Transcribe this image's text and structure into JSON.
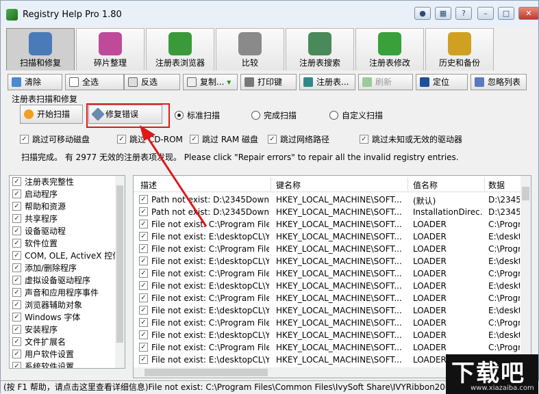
{
  "window": {
    "title": "Registry Help Pro 1.80"
  },
  "tabs": [
    {
      "label": "扫描和修复",
      "icon": "tools-icon",
      "active": true
    },
    {
      "label": "碎片整理",
      "icon": "defrag-icon"
    },
    {
      "label": "注册表浏览器",
      "icon": "cubes-icon"
    },
    {
      "label": "比较",
      "icon": "scale-icon"
    },
    {
      "label": "注册表搜索",
      "icon": "magnifier-icon"
    },
    {
      "label": "注册表修改",
      "icon": "cube-edit-icon"
    },
    {
      "label": "历史和备份",
      "icon": "clock-icon"
    }
  ],
  "toolbar": {
    "clear": "清除",
    "select_all": "全选",
    "invert": "反选",
    "copy": "复制...",
    "print": "打印键",
    "registry": "注册表...",
    "refresh": "刷新",
    "locate": "定位",
    "ignore_list": "忽略列表"
  },
  "scan": {
    "section_title": "注册表扫描和修复",
    "start_label": "开始扫描",
    "repair_label": "修复错误",
    "radio_standard": "标准扫描",
    "radio_full": "完成扫描",
    "radio_custom": "自定义扫描",
    "skip_removable": "跳过可移动磁盘",
    "skip_cdrom": "跳过 CD-ROM",
    "skip_ram": "跳过 RAM 磁盘",
    "skip_network": "跳过网络路径",
    "skip_unknown": "跳过未知或无效的驱动器",
    "status": "扫描完成。 有 2977 无效的注册表项发现。 Please click \"Repair errors\" to repair all the invalid registry entries."
  },
  "categories": [
    "注册表完整性",
    "启动程序",
    "帮助和资源",
    "共享程序",
    "设备驱动程",
    "软件位置",
    "COM, OLE, ActiveX 控件",
    "添加/删除程序",
    "虚拟设备驱动程序",
    "声音和应用程序事件",
    "浏览器辅助对象",
    "Windows 字体",
    "安装程序",
    "文件扩展名",
    "用户软件设置",
    "系统软件设置"
  ],
  "results": {
    "headers": [
      "描述",
      "键名称",
      "值名称",
      "数据"
    ],
    "rows": [
      [
        "Path not exist: D:\\2345Downl...",
        "HKEY_LOCAL_MACHINE\\SOFT...",
        "(默认)",
        "D:\\2345"
      ],
      [
        "Path not exist: D:\\2345Downl...",
        "HKEY_LOCAL_MACHINE\\SOFT...",
        "InstallationDirec...",
        "D:\\2345"
      ],
      [
        "File not exist: C:\\Program Files...",
        "HKEY_LOCAL_MACHINE\\SOFT...",
        "LOADER",
        "C:\\Progr"
      ],
      [
        "File not exist: E:\\desktopCL\\Y...",
        "HKEY_LOCAL_MACHINE\\SOFT...",
        "LOADER",
        "E:\\deskt"
      ],
      [
        "File not exist: C:\\Program Files...",
        "HKEY_LOCAL_MACHINE\\SOFT...",
        "LOADER",
        "C:\\Progr"
      ],
      [
        "File not exist: E:\\desktopCL\\Y...",
        "HKEY_LOCAL_MACHINE\\SOFT...",
        "LOADER",
        "E:\\deskt"
      ],
      [
        "File not exist: C:\\Program Files...",
        "HKEY_LOCAL_MACHINE\\SOFT...",
        "LOADER",
        "C:\\Progr"
      ],
      [
        "File not exist: E:\\desktopCL\\Y...",
        "HKEY_LOCAL_MACHINE\\SOFT...",
        "LOADER",
        "E:\\deskt"
      ],
      [
        "File not exist: C:\\Program Files...",
        "HKEY_LOCAL_MACHINE\\SOFT...",
        "LOADER",
        "C:\\Progr"
      ],
      [
        "File not exist: E:\\desktopCL\\Y...",
        "HKEY_LOCAL_MACHINE\\SOFT...",
        "LOADER",
        "E:\\deskt"
      ],
      [
        "File not exist: C:\\Program Files...",
        "HKEY_LOCAL_MACHINE\\SOFT...",
        "LOADER",
        "C:\\Progr"
      ],
      [
        "File not exist: E:\\desktopCL\\Y...",
        "HKEY_LOCAL_MACHINE\\SOFT...",
        "LOADER",
        "E:\\deskt"
      ],
      [
        "File not exist: C:\\Program Files...",
        "HKEY_LOCAL_MACHINE\\SOFT...",
        "LOADER",
        "C:\\Progr"
      ],
      [
        "File not exist: E:\\desktopCL\\Y...",
        "HKEY_LOCAL_MACHINE\\SOFT...",
        "LOADER",
        "E:\\deskt"
      ]
    ]
  },
  "statusbar": "(按 F1 帮助，请点击这里查看详细信息)File not exist: C:\\Program Files\\Common Files\\IvySoft Share\\IVYRibbon2007.dll",
  "watermark": {
    "text": "下载吧",
    "url": "www.xiazaiba.com"
  },
  "colors": {
    "highlight": "#e01818",
    "active_tab": "#cfcfcf"
  }
}
